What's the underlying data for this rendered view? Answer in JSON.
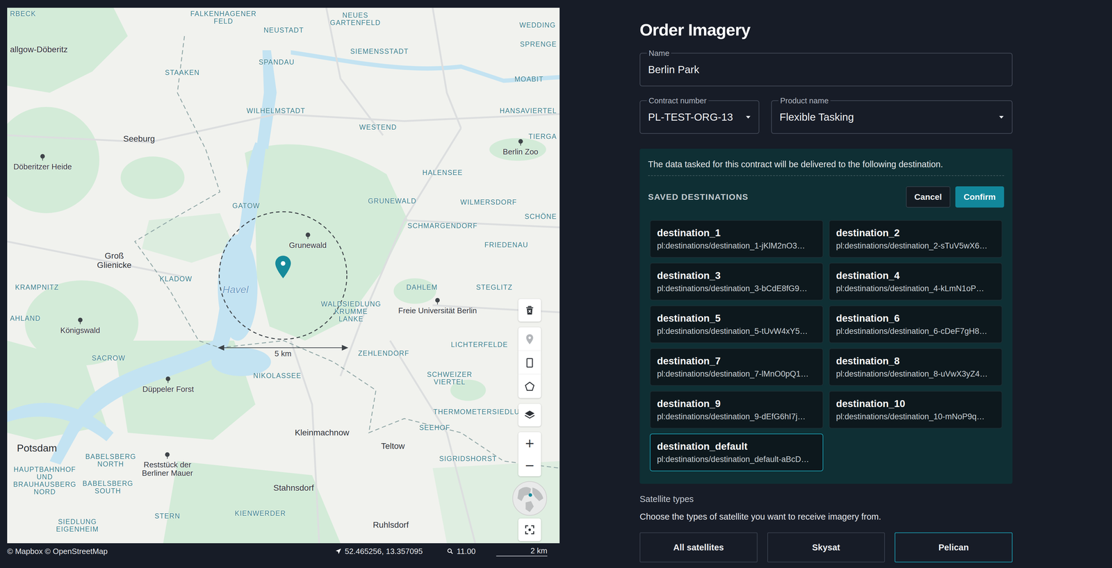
{
  "map": {
    "labels": [
      {
        "text": "RBECK",
        "kind": "district"
      },
      {
        "text": "allgow-Döberitz",
        "kind": "place"
      },
      {
        "text": "FALKENHAGENER\nFELD",
        "kind": "district"
      },
      {
        "text": "NEUES\nGARTENFELD",
        "kind": "district"
      },
      {
        "text": "NEUSTADT",
        "kind": "district"
      },
      {
        "text": "WEDDING",
        "kind": "district"
      },
      {
        "text": "SIEMENSSTADT",
        "kind": "district"
      },
      {
        "text": "SPRENGE",
        "kind": "district"
      },
      {
        "text": "SPANDAU",
        "kind": "district"
      },
      {
        "text": "STAAKEN",
        "kind": "district"
      },
      {
        "text": "MOABIT",
        "kind": "district"
      },
      {
        "text": "WILHELMSTADT",
        "kind": "district"
      },
      {
        "text": "HANSAVIERTEL",
        "kind": "district"
      },
      {
        "text": "WESTEND",
        "kind": "district"
      },
      {
        "text": "Seeburg",
        "kind": "place"
      },
      {
        "text": "TIERGA",
        "kind": "district"
      },
      {
        "text": "Berlin Zoo",
        "kind": "poi"
      },
      {
        "text": "Döberitzer Heide",
        "kind": "poi"
      },
      {
        "text": "HALENSEE",
        "kind": "district"
      },
      {
        "text": "GATOW",
        "kind": "district"
      },
      {
        "text": "GRUNEWALD",
        "kind": "district"
      },
      {
        "text": "WILMERSDORF",
        "kind": "district"
      },
      {
        "text": "SCHÖNE",
        "kind": "district"
      },
      {
        "text": "SCHMARGENDORF",
        "kind": "district"
      },
      {
        "text": "Grunewald",
        "kind": "poi"
      },
      {
        "text": "FRIEDENAU",
        "kind": "district"
      },
      {
        "text": "Groß\nGlienicke",
        "kind": "place"
      },
      {
        "text": "KLADOW",
        "kind": "district"
      },
      {
        "text": "Havel",
        "kind": "water"
      },
      {
        "text": "KRAMPNITZ",
        "kind": "district"
      },
      {
        "text": "DAHLEM",
        "kind": "district"
      },
      {
        "text": "STEGLITZ",
        "kind": "district"
      },
      {
        "text": "WALDSIEDLUNG\nKRUMME\nLANKE",
        "kind": "district"
      },
      {
        "text": "Freie Universität Berlin",
        "kind": "poi"
      },
      {
        "text": "AHLAND",
        "kind": "district"
      },
      {
        "text": "Königswald",
        "kind": "poi"
      },
      {
        "text": "ZEHLENDORF",
        "kind": "district"
      },
      {
        "text": "LICHTERFELDE",
        "kind": "district"
      },
      {
        "text": "SACROW",
        "kind": "district"
      },
      {
        "text": "NIKOLASSEE",
        "kind": "district"
      },
      {
        "text": "SCHWEIZER\nVIERTEL",
        "kind": "district"
      },
      {
        "text": "Düppeler Forst",
        "kind": "poi"
      },
      {
        "text": "THERMOMETERSIEDLUN",
        "kind": "district"
      },
      {
        "text": "SEEHOF",
        "kind": "district"
      },
      {
        "text": "Kleinmachnow",
        "kind": "place"
      },
      {
        "text": "Teltow",
        "kind": "place"
      },
      {
        "text": "Potsdam",
        "kind": "town"
      },
      {
        "text": "SIGRIDSHORST",
        "kind": "district"
      },
      {
        "text": "BABELSBERG\nNORTH",
        "kind": "district"
      },
      {
        "text": "HAUPTBAHNHOF\nUND\nBRAUHAUSBERG\nNORD",
        "kind": "district"
      },
      {
        "text": "Reststück der\nBerliner Mauer",
        "kind": "poi"
      },
      {
        "text": "BABELSBERG\nSOUTH",
        "kind": "district"
      },
      {
        "text": "Stahnsdorf",
        "kind": "place"
      },
      {
        "text": "STERN",
        "kind": "district"
      },
      {
        "text": "KIENWERDER",
        "kind": "district"
      },
      {
        "text": "SIEDLUNG\nEIGENHEIM",
        "kind": "district"
      },
      {
        "text": "Ruhlsdorf",
        "kind": "place"
      }
    ],
    "search_radius": "5 km",
    "tools": [
      {
        "kind": "delete",
        "disabled": false
      },
      {
        "kind": "point",
        "disabled": true
      },
      {
        "kind": "rectangle",
        "disabled": false
      },
      {
        "kind": "polygon",
        "disabled": false
      }
    ],
    "zoom_in": "+",
    "zoom_out": "−",
    "attribution": "© Mapbox © OpenStreetMap",
    "coordinates": "52.465256, 13.357095",
    "zoom": "11.00",
    "scale": "2 km"
  },
  "form": {
    "title": "Order Imagery",
    "name": {
      "label": "Name",
      "value": "Berlin Park"
    },
    "contract": {
      "label": "Contract number",
      "value": "PL-TEST-ORG-13"
    },
    "product": {
      "label": "Product name",
      "value": "Flexible Tasking"
    },
    "delivery": {
      "note": "The data tasked for this contract will be delivered to the following destination.",
      "heading": "SAVED DESTINATIONS",
      "cancel": "Cancel",
      "confirm": "Confirm",
      "destinations": [
        {
          "name": "destination_1",
          "path": "pl:destinations/destination_1-jKlM2nO3…",
          "selected": false
        },
        {
          "name": "destination_2",
          "path": "pl:destinations/destination_2-sTuV5wX6…",
          "selected": false
        },
        {
          "name": "destination_3",
          "path": "pl:destinations/destination_3-bCdE8fG9…",
          "selected": false
        },
        {
          "name": "destination_4",
          "path": "pl:destinations/destination_4-kLmN1oP…",
          "selected": false
        },
        {
          "name": "destination_5",
          "path": "pl:destinations/destination_5-tUvW4xY5…",
          "selected": false
        },
        {
          "name": "destination_6",
          "path": "pl:destinations/destination_6-cDeF7gH8…",
          "selected": false
        },
        {
          "name": "destination_7",
          "path": "pl:destinations/destination_7-lMnO0pQ1…",
          "selected": false
        },
        {
          "name": "destination_8",
          "path": "pl:destinations/destination_8-uVwX3yZ4…",
          "selected": false
        },
        {
          "name": "destination_9",
          "path": "pl:destinations/destination_9-dEfG6hI7j…",
          "selected": false
        },
        {
          "name": "destination_10",
          "path": "pl:destinations/destination_10-mNoP9q…",
          "selected": false
        },
        {
          "name": "destination_default",
          "path": "pl:destinations/destination_default-aBcD…",
          "selected": true
        }
      ]
    },
    "satellites": {
      "label": "Satellite types",
      "hint": "Choose the types of satellite you want to receive imagery from.",
      "options": [
        {
          "label": "All satellites",
          "selected": false
        },
        {
          "label": "Skysat",
          "selected": false
        },
        {
          "label": "Pelican",
          "selected": true
        }
      ]
    }
  }
}
